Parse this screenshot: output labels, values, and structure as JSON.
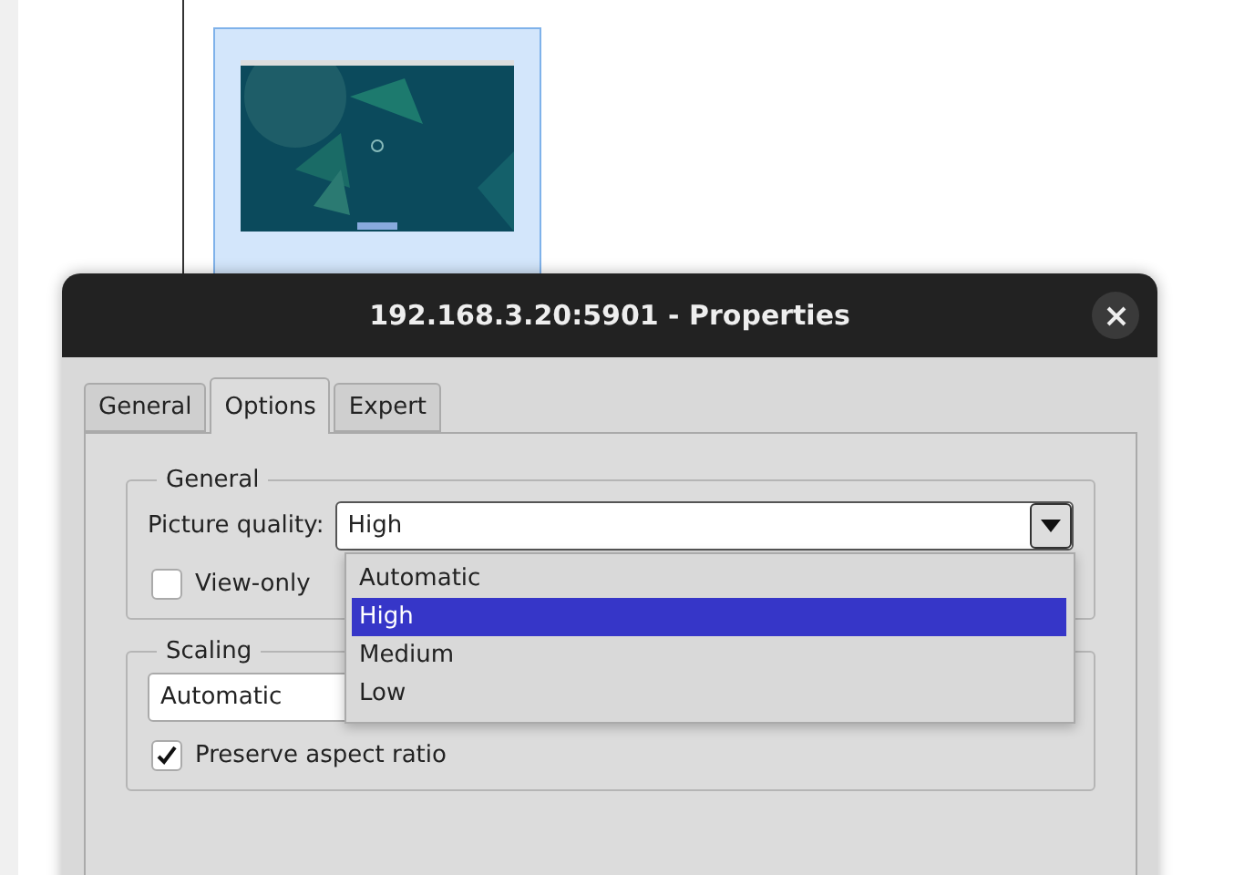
{
  "thumbnail": {
    "kind": "picture",
    "selected": true
  },
  "window": {
    "title": "192.168.3.20:5901 - Properties"
  },
  "tabs": [
    {
      "label": "General",
      "selected": false
    },
    {
      "label": "Options",
      "selected": true
    },
    {
      "label": "Expert",
      "selected": false
    }
  ],
  "general_group": {
    "title": "General",
    "picture_quality": {
      "label": "Picture quality:",
      "value": "High",
      "open": true,
      "options": [
        {
          "label": "Automatic",
          "selected": false
        },
        {
          "label": "High",
          "selected": true
        },
        {
          "label": "Medium",
          "selected": false
        },
        {
          "label": "Low",
          "selected": false
        }
      ]
    },
    "view_only": {
      "label": "View-only",
      "checked": false
    }
  },
  "scaling_group": {
    "title": "Scaling",
    "mode": "Automatic",
    "preserve_aspect": {
      "label": "Preserve aspect ratio",
      "checked": true
    }
  }
}
